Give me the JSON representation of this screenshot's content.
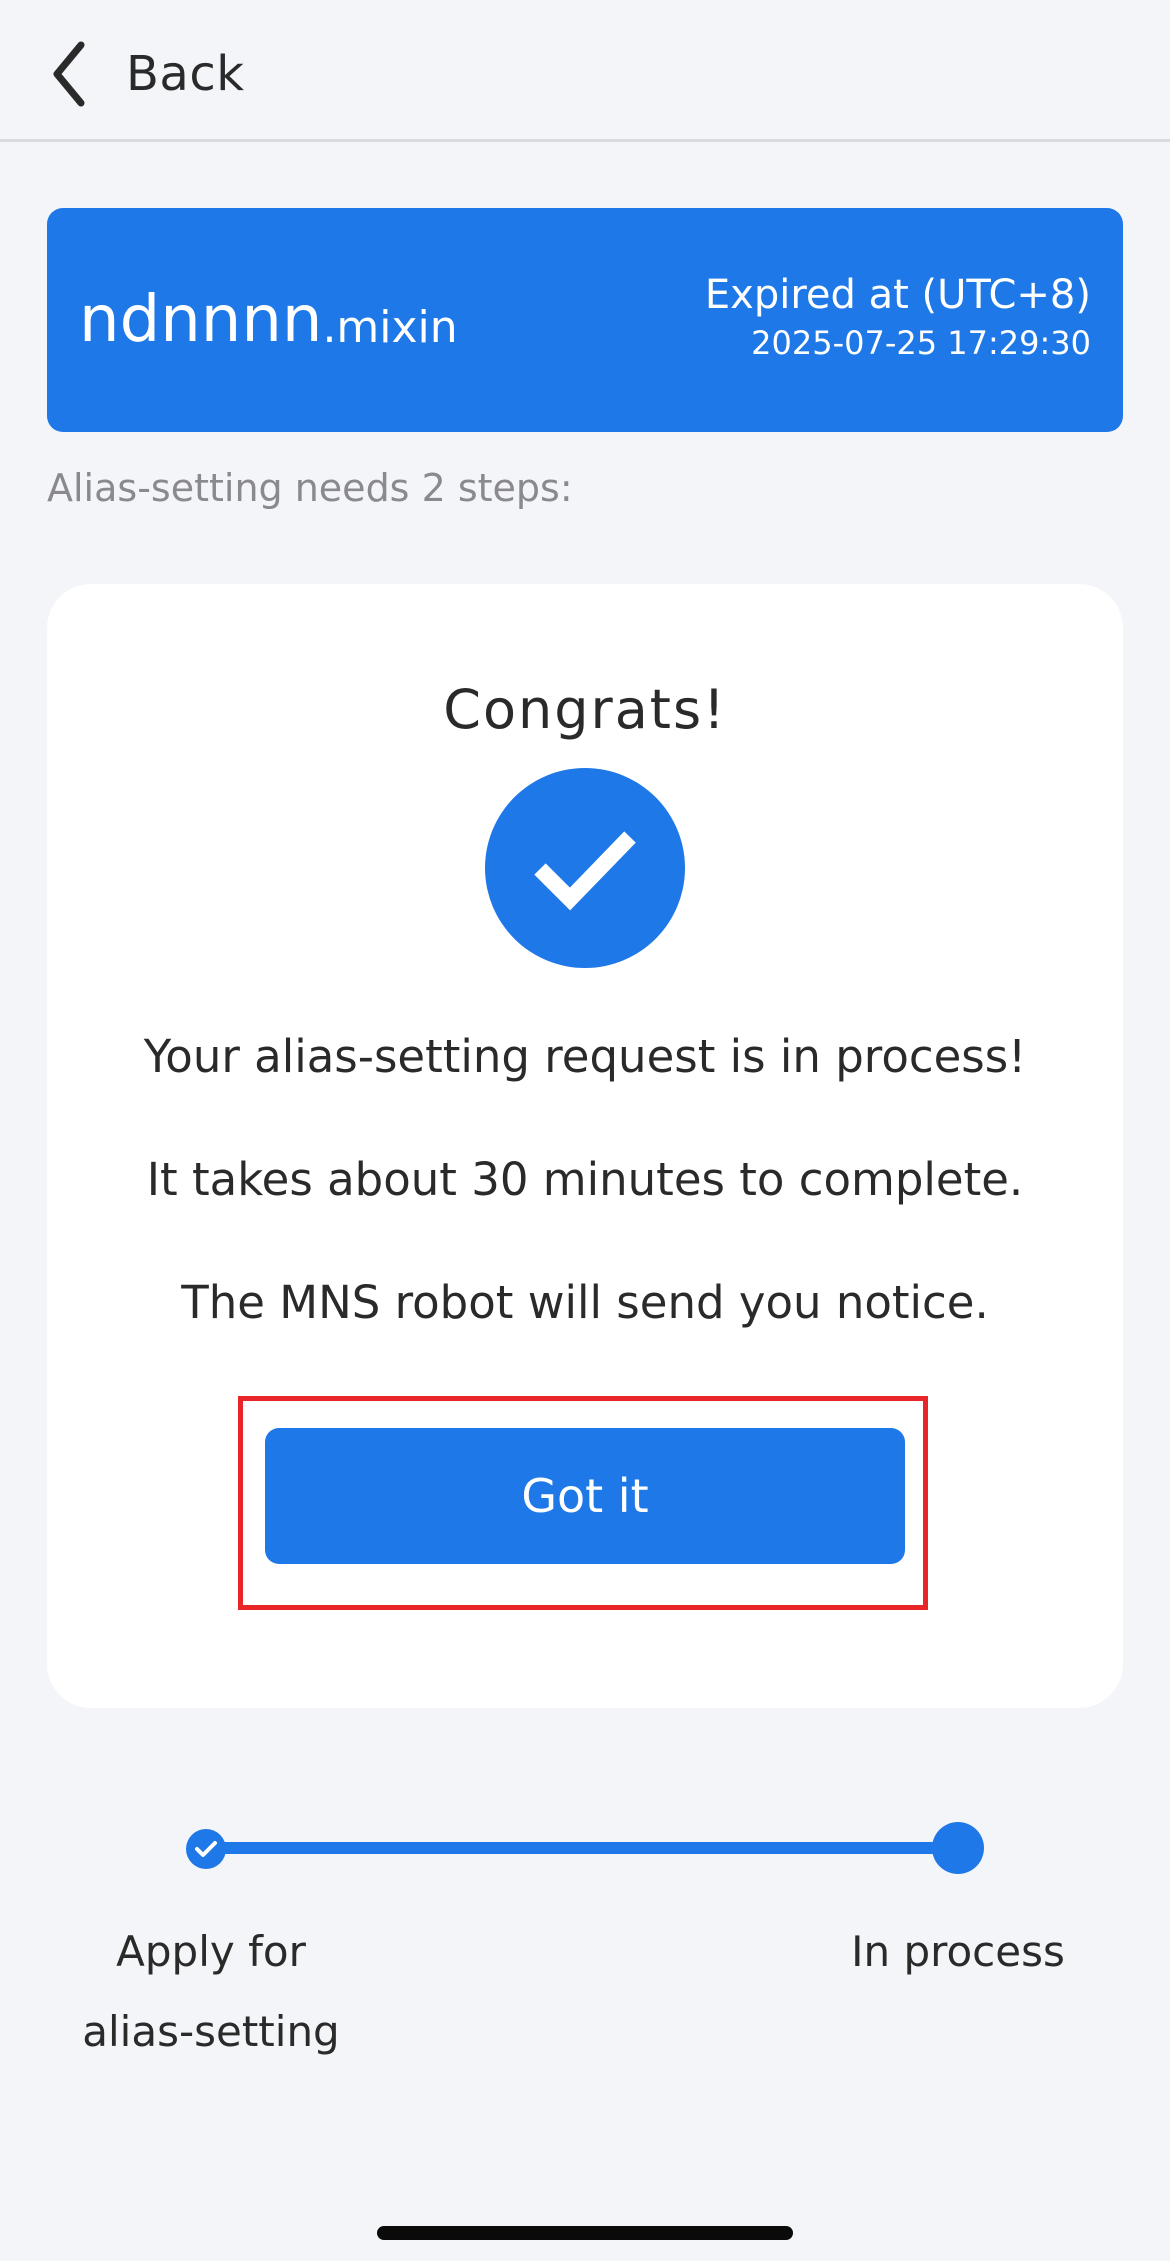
{
  "header": {
    "back_label": "Back"
  },
  "alias_card": {
    "name": "ndnnnn",
    "suffix": ".mixin",
    "expiry_label": "Expired at (UTC+8)",
    "expiry_datetime": "2025-07-25 17:29:30"
  },
  "steps_note": "Alias-setting needs 2 steps:",
  "result": {
    "title": "Congrats!",
    "messages": [
      "Your alias-setting request is in process!",
      "It takes about 30 minutes to complete.",
      "The MNS robot will send you notice."
    ],
    "button_label": "Got it"
  },
  "progress": {
    "steps": [
      {
        "label_line1": "Apply for",
        "label_line2": "alias-setting",
        "state": "done"
      },
      {
        "label_line1": "In process",
        "state": "current"
      }
    ]
  },
  "colors": {
    "accent": "#1f78e8",
    "background": "#f4f5f9",
    "highlight": "#e8262a"
  },
  "icons": [
    "chevron-left-icon",
    "checkmark-icon",
    "small-check-icon"
  ]
}
